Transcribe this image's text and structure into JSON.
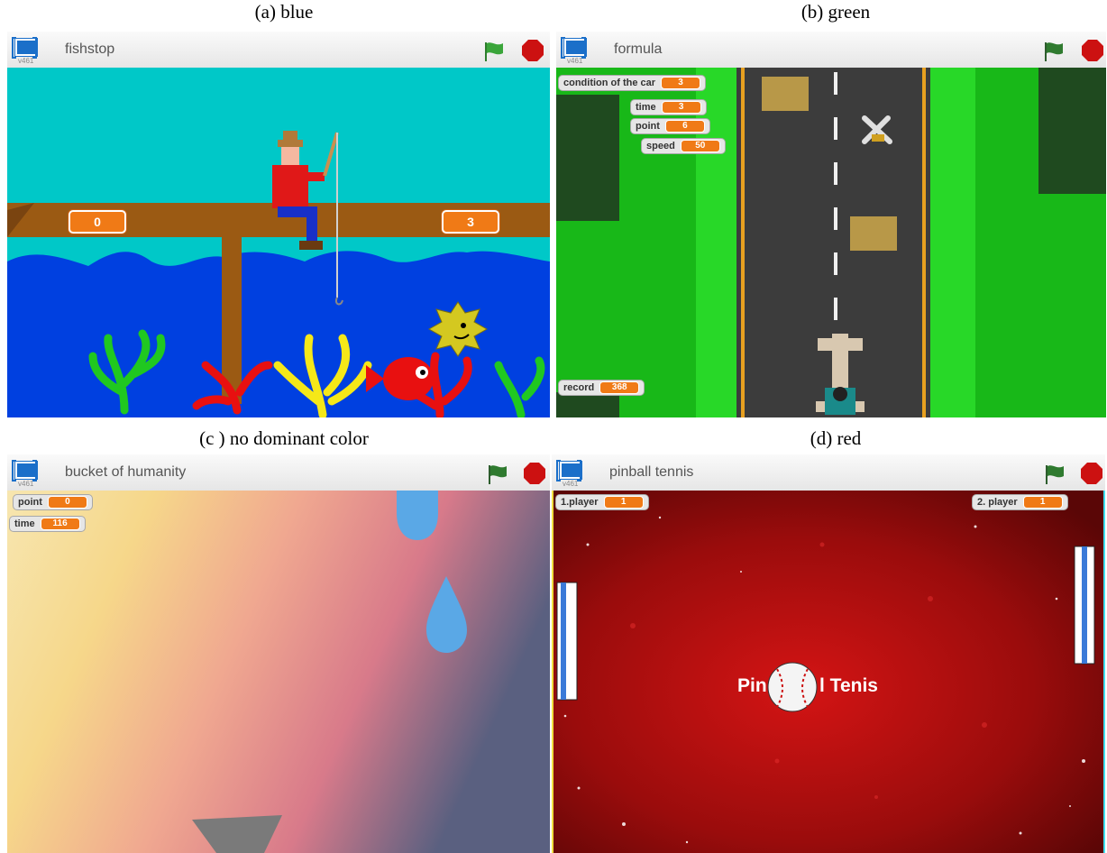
{
  "captions": {
    "a": "(a)  blue",
    "b": "(b) green",
    "c": "(c ) no dominant color",
    "d": "(d) red"
  },
  "version": "v461",
  "colors": {
    "flag": "#3aa53a",
    "stop": "#cc1111",
    "monitor_value": "#f07a16",
    "present_icon": "#1b6fc9"
  },
  "icons": [
    "presentation-icon",
    "green-flag-icon",
    "stop-sign-icon"
  ],
  "panel_a": {
    "title": "fishstop",
    "score_left": "0",
    "score_right": "3"
  },
  "panel_b": {
    "title": "formula",
    "monitors": [
      {
        "label": "condition of the car",
        "value": "3"
      },
      {
        "label": "time",
        "value": "3"
      },
      {
        "label": "point",
        "value": "6"
      },
      {
        "label": "speed",
        "value": "50"
      },
      {
        "label": "record",
        "value": "368"
      }
    ]
  },
  "panel_c": {
    "title": "bucket of humanity",
    "monitors": [
      {
        "label": "point",
        "value": "0"
      },
      {
        "label": "time",
        "value": "116"
      }
    ]
  },
  "panel_d": {
    "title": "pinball tennis",
    "monitors": [
      {
        "label": "1.player",
        "value": "1"
      },
      {
        "label": "2. player",
        "value": "1"
      }
    ],
    "logo_text_left": "Pin",
    "logo_text_right": "l Tenis"
  }
}
